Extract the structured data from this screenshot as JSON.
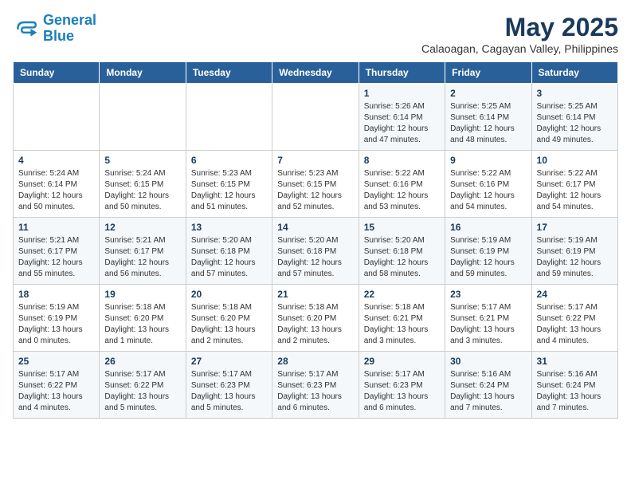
{
  "logo": {
    "line1": "General",
    "line2": "Blue"
  },
  "title": "May 2025",
  "subtitle": "Calaoagan, Cagayan Valley, Philippines",
  "days_header": [
    "Sunday",
    "Monday",
    "Tuesday",
    "Wednesday",
    "Thursday",
    "Friday",
    "Saturday"
  ],
  "weeks": [
    [
      {
        "day": "",
        "info": ""
      },
      {
        "day": "",
        "info": ""
      },
      {
        "day": "",
        "info": ""
      },
      {
        "day": "",
        "info": ""
      },
      {
        "day": "1",
        "info": "Sunrise: 5:26 AM\nSunset: 6:14 PM\nDaylight: 12 hours\nand 47 minutes."
      },
      {
        "day": "2",
        "info": "Sunrise: 5:25 AM\nSunset: 6:14 PM\nDaylight: 12 hours\nand 48 minutes."
      },
      {
        "day": "3",
        "info": "Sunrise: 5:25 AM\nSunset: 6:14 PM\nDaylight: 12 hours\nand 49 minutes."
      }
    ],
    [
      {
        "day": "4",
        "info": "Sunrise: 5:24 AM\nSunset: 6:14 PM\nDaylight: 12 hours\nand 50 minutes."
      },
      {
        "day": "5",
        "info": "Sunrise: 5:24 AM\nSunset: 6:15 PM\nDaylight: 12 hours\nand 50 minutes."
      },
      {
        "day": "6",
        "info": "Sunrise: 5:23 AM\nSunset: 6:15 PM\nDaylight: 12 hours\nand 51 minutes."
      },
      {
        "day": "7",
        "info": "Sunrise: 5:23 AM\nSunset: 6:15 PM\nDaylight: 12 hours\nand 52 minutes."
      },
      {
        "day": "8",
        "info": "Sunrise: 5:22 AM\nSunset: 6:16 PM\nDaylight: 12 hours\nand 53 minutes."
      },
      {
        "day": "9",
        "info": "Sunrise: 5:22 AM\nSunset: 6:16 PM\nDaylight: 12 hours\nand 54 minutes."
      },
      {
        "day": "10",
        "info": "Sunrise: 5:22 AM\nSunset: 6:17 PM\nDaylight: 12 hours\nand 54 minutes."
      }
    ],
    [
      {
        "day": "11",
        "info": "Sunrise: 5:21 AM\nSunset: 6:17 PM\nDaylight: 12 hours\nand 55 minutes."
      },
      {
        "day": "12",
        "info": "Sunrise: 5:21 AM\nSunset: 6:17 PM\nDaylight: 12 hours\nand 56 minutes."
      },
      {
        "day": "13",
        "info": "Sunrise: 5:20 AM\nSunset: 6:18 PM\nDaylight: 12 hours\nand 57 minutes."
      },
      {
        "day": "14",
        "info": "Sunrise: 5:20 AM\nSunset: 6:18 PM\nDaylight: 12 hours\nand 57 minutes."
      },
      {
        "day": "15",
        "info": "Sunrise: 5:20 AM\nSunset: 6:18 PM\nDaylight: 12 hours\nand 58 minutes."
      },
      {
        "day": "16",
        "info": "Sunrise: 5:19 AM\nSunset: 6:19 PM\nDaylight: 12 hours\nand 59 minutes."
      },
      {
        "day": "17",
        "info": "Sunrise: 5:19 AM\nSunset: 6:19 PM\nDaylight: 12 hours\nand 59 minutes."
      }
    ],
    [
      {
        "day": "18",
        "info": "Sunrise: 5:19 AM\nSunset: 6:19 PM\nDaylight: 13 hours\nand 0 minutes."
      },
      {
        "day": "19",
        "info": "Sunrise: 5:18 AM\nSunset: 6:20 PM\nDaylight: 13 hours\nand 1 minute."
      },
      {
        "day": "20",
        "info": "Sunrise: 5:18 AM\nSunset: 6:20 PM\nDaylight: 13 hours\nand 2 minutes."
      },
      {
        "day": "21",
        "info": "Sunrise: 5:18 AM\nSunset: 6:20 PM\nDaylight: 13 hours\nand 2 minutes."
      },
      {
        "day": "22",
        "info": "Sunrise: 5:18 AM\nSunset: 6:21 PM\nDaylight: 13 hours\nand 3 minutes."
      },
      {
        "day": "23",
        "info": "Sunrise: 5:17 AM\nSunset: 6:21 PM\nDaylight: 13 hours\nand 3 minutes."
      },
      {
        "day": "24",
        "info": "Sunrise: 5:17 AM\nSunset: 6:22 PM\nDaylight: 13 hours\nand 4 minutes."
      }
    ],
    [
      {
        "day": "25",
        "info": "Sunrise: 5:17 AM\nSunset: 6:22 PM\nDaylight: 13 hours\nand 4 minutes."
      },
      {
        "day": "26",
        "info": "Sunrise: 5:17 AM\nSunset: 6:22 PM\nDaylight: 13 hours\nand 5 minutes."
      },
      {
        "day": "27",
        "info": "Sunrise: 5:17 AM\nSunset: 6:23 PM\nDaylight: 13 hours\nand 5 minutes."
      },
      {
        "day": "28",
        "info": "Sunrise: 5:17 AM\nSunset: 6:23 PM\nDaylight: 13 hours\nand 6 minutes."
      },
      {
        "day": "29",
        "info": "Sunrise: 5:17 AM\nSunset: 6:23 PM\nDaylight: 13 hours\nand 6 minutes."
      },
      {
        "day": "30",
        "info": "Sunrise: 5:16 AM\nSunset: 6:24 PM\nDaylight: 13 hours\nand 7 minutes."
      },
      {
        "day": "31",
        "info": "Sunrise: 5:16 AM\nSunset: 6:24 PM\nDaylight: 13 hours\nand 7 minutes."
      }
    ]
  ]
}
